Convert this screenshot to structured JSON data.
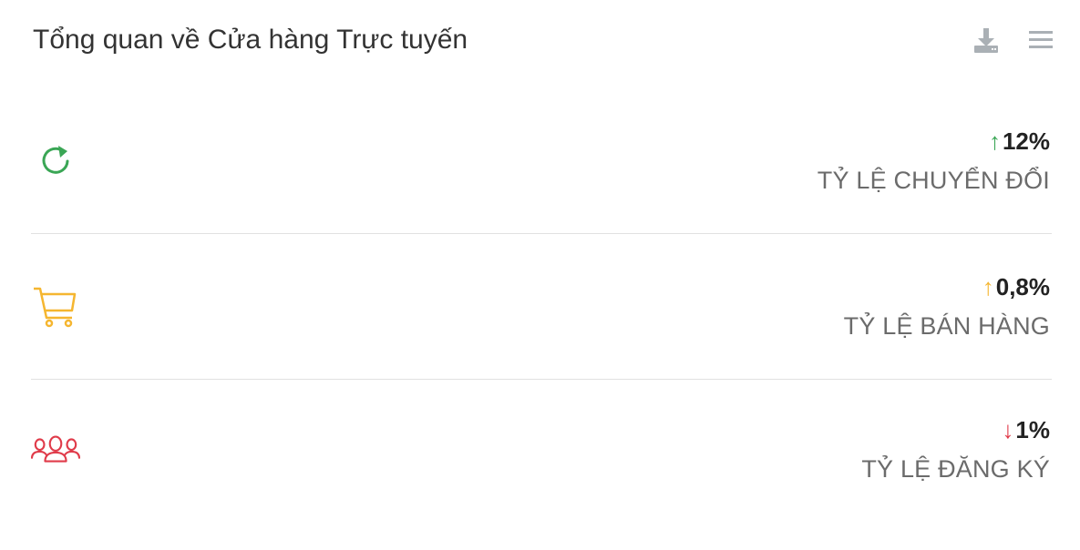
{
  "header": {
    "title": "Tổng quan về Cửa hàng Trực tuyến",
    "actions": [
      {
        "icon": "download-icon"
      },
      {
        "icon": "menu-icon"
      }
    ]
  },
  "metrics": [
    {
      "icon": "refresh-icon",
      "arrow": "↑",
      "value": "12%",
      "label": "TỶ LỆ CHUYỂN ĐỔI",
      "color": "#3aa655"
    },
    {
      "icon": "cart-icon",
      "arrow": "↑",
      "value": "0,8%",
      "label": "TỶ LỆ BÁN HÀNG",
      "color": "#f5b630"
    },
    {
      "icon": "users-icon",
      "arrow": "↓",
      "value": "1%",
      "label": "TỶ LỆ ĐĂNG KÝ",
      "color": "#e03b4a"
    }
  ],
  "colors": {
    "icon_gray": "#aab0b5",
    "divider": "#e1e1e1",
    "text": "#333333",
    "label": "#6b6b6b"
  }
}
